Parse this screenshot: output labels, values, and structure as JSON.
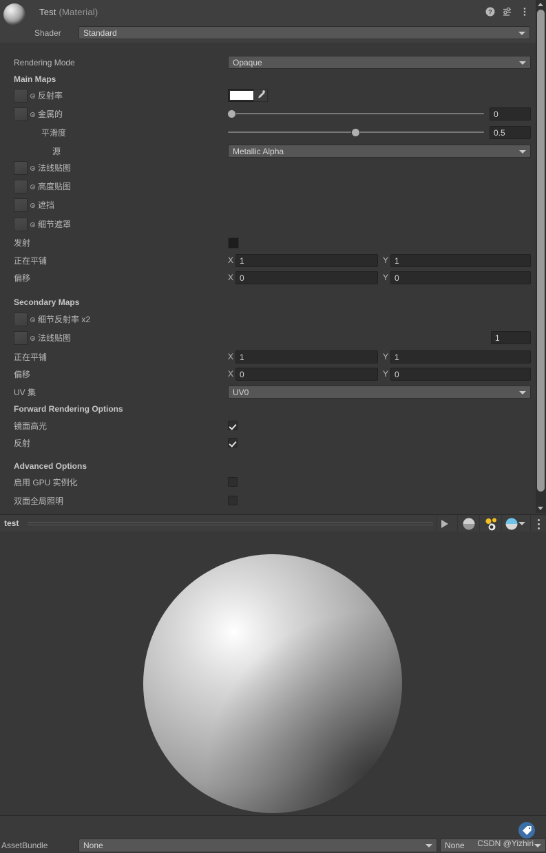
{
  "header": {
    "title_name": "Test",
    "title_type": "(Material)",
    "icons": [
      "help-icon",
      "preset-icon",
      "menu-icon"
    ],
    "shader_label": "Shader",
    "shader_value": "Standard"
  },
  "properties": {
    "rendering_mode": {
      "label": "Rendering Mode",
      "value": "Opaque"
    },
    "main_maps_header": "Main Maps",
    "albedo": {
      "label": "反射率",
      "color": "#ffffff"
    },
    "metallic": {
      "label": "金属的",
      "value": "0",
      "slider_pct": 0
    },
    "smoothness": {
      "label": "平滑度",
      "value": "0.5",
      "slider_pct": 50
    },
    "source": {
      "label": "源",
      "value": "Metallic Alpha"
    },
    "normal_map": {
      "label": "法线贴图"
    },
    "height_map": {
      "label": "高度贴图"
    },
    "occlusion": {
      "label": "遮挡"
    },
    "detail_mask": {
      "label": "细节遮罩"
    },
    "emission": {
      "label": "发射",
      "color": "#000000"
    },
    "tiling": {
      "label": "正在平铺",
      "x_axis": "X",
      "x": "1",
      "y_axis": "Y",
      "y": "1"
    },
    "offset": {
      "label": "偏移",
      "x_axis": "X",
      "x": "0",
      "y_axis": "Y",
      "y": "0"
    },
    "secondary_maps_header": "Secondary Maps",
    "detail_albedo": {
      "label": "细节反射率 x2"
    },
    "detail_normal": {
      "label": "法线贴图",
      "scale": "1"
    },
    "tiling2": {
      "label": "正在平铺",
      "x_axis": "X",
      "x": "1",
      "y_axis": "Y",
      "y": "1"
    },
    "offset2": {
      "label": "偏移",
      "x_axis": "X",
      "x": "0",
      "y_axis": "Y",
      "y": "0"
    },
    "uv_set": {
      "label": "UV 集",
      "value": "UV0"
    },
    "forward_header": "Forward Rendering Options",
    "specular_highlights": {
      "label": "镜面高光",
      "checked": true
    },
    "reflections": {
      "label": "反射",
      "checked": true
    },
    "advanced_header": "Advanced Options",
    "gpu_instancing": {
      "label": "启用 GPU 实例化",
      "checked": false
    },
    "double_sided_gi": {
      "label": "双面全局照明",
      "checked": false
    }
  },
  "preview_toolbar": {
    "name": "test",
    "buttons": [
      "play-icon",
      "preview-sphere-icon",
      "lighting-icon",
      "environment-sphere-icon",
      "overflow-menu-icon"
    ]
  },
  "bottom": {
    "assetbundle_label": "AssetBundle",
    "assetbundle_value": "None",
    "variant_value": "None",
    "watermark": "CSDN @Yizhiri"
  },
  "colors": {
    "panel_bg": "#383838",
    "header_bg": "#3f3f3f",
    "field_bg": "#565656",
    "input_bg": "#2a2a2a",
    "text": "#b9b9b9",
    "accent_blue": "#3c6fa8"
  }
}
